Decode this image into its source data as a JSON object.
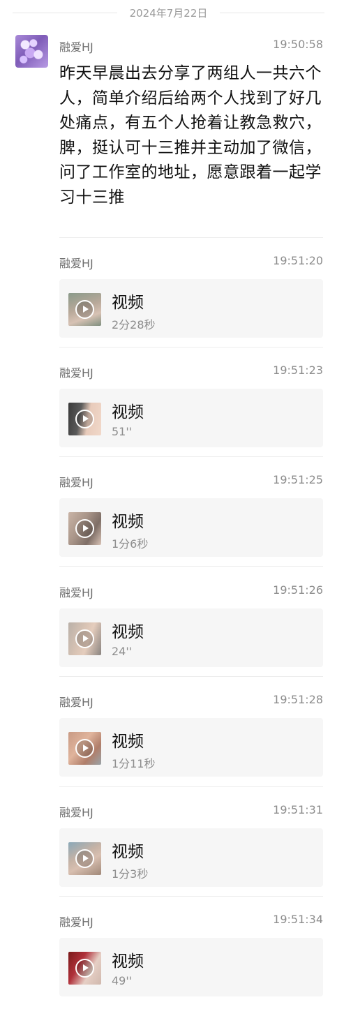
{
  "date_divider": "2024年7月22日",
  "messages": [
    {
      "sender": "融爱HJ",
      "time": "19:50:58",
      "text": "昨天早晨出去分享了两组人一共六个人，简单介绍后给两个人找到了好几处痛点，有五个人抢着让教急救穴，脾，挺认可十三推并主动加了微信，问了工作室的地址，愿意跟着一起学习十三推"
    },
    {
      "sender": "融爱HJ",
      "time": "19:51:20",
      "video": {
        "title": "视频",
        "duration": "2分28秒"
      }
    },
    {
      "sender": "融爱HJ",
      "time": "19:51:23",
      "video": {
        "title": "视频",
        "duration": "51''"
      }
    },
    {
      "sender": "融爱HJ",
      "time": "19:51:25",
      "video": {
        "title": "视频",
        "duration": "1分6秒"
      }
    },
    {
      "sender": "融爱HJ",
      "time": "19:51:26",
      "video": {
        "title": "视频",
        "duration": "24''"
      }
    },
    {
      "sender": "融爱HJ",
      "time": "19:51:28",
      "video": {
        "title": "视频",
        "duration": "1分11秒"
      }
    },
    {
      "sender": "融爱HJ",
      "time": "19:51:31",
      "video": {
        "title": "视频",
        "duration": "1分3秒"
      }
    },
    {
      "sender": "融爱HJ",
      "time": "19:51:34",
      "video": {
        "title": "视频",
        "duration": "49''"
      }
    }
  ],
  "icons": {
    "video_thumbnail": "play-icon"
  }
}
